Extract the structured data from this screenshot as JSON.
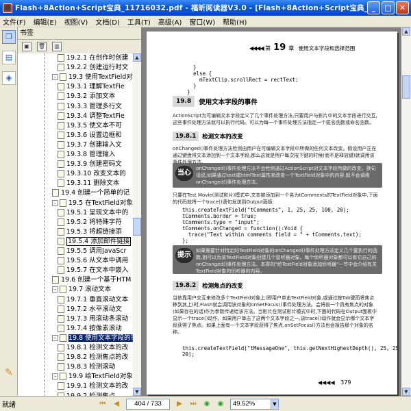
{
  "window": {
    "title": "Flash+8Action+Script宝典_11716032.pdf - 福昕阅读器V3.0 - [Flash+8Action+Script宝典_11...",
    "app_icon": "pdf-icon",
    "minimize": "_",
    "maximize": "□",
    "close": "✕"
  },
  "menu": [
    "文件(F)",
    "编辑(E)",
    "视图(V)",
    "文档(D)",
    "工具(T)",
    "高级(A)",
    "窗口(W)",
    "帮助(H)"
  ],
  "sidebar": {
    "header": "书签",
    "tabs": [
      "bookmark-icon",
      "pages-icon",
      "layers-icon"
    ]
  },
  "bookmarks": [
    {
      "label": "19.2.1 在创作时创建",
      "level": 2
    },
    {
      "label": "19.2.2 创建运行时文",
      "level": 2
    },
    {
      "label": "19.3 使用TextField对象",
      "level": 1,
      "expander": "-"
    },
    {
      "label": "19.3.1 理解TextFie",
      "level": 2
    },
    {
      "label": "19.3.2 添加文本",
      "level": 2
    },
    {
      "label": "19.3.3 管理多行文",
      "level": 2
    },
    {
      "label": "19.3.4 调整TextFie",
      "level": 2
    },
    {
      "label": "19.3.5 使文本不可",
      "level": 2
    },
    {
      "label": "19.3.6 设置边框和",
      "level": 2
    },
    {
      "label": "19.3.7 创建输入文",
      "level": 2
    },
    {
      "label": "19.3.8 管理输入",
      "level": 2
    },
    {
      "label": "19.3.9 创建密码文",
      "level": 2
    },
    {
      "label": "19.3.10 改变文本的",
      "level": 2
    },
    {
      "label": "19.3.11 删除文本",
      "level": 2
    },
    {
      "label": "19.4 创建一个简单的记",
      "level": 1
    },
    {
      "label": "19.5 在TextField对象中",
      "level": 1,
      "expander": "-"
    },
    {
      "label": "19.5.1 呈现文本中的",
      "level": 2
    },
    {
      "label": "19.5.2 将特殊字符",
      "level": 2
    },
    {
      "label": "19.5.3 将超链接添",
      "level": 2
    },
    {
      "label": "19.5.4 添加邮件链接",
      "level": 2,
      "boxed": true
    },
    {
      "label": "19.5.5 调用JavaScr",
      "level": 2
    },
    {
      "label": "19.5.6 从文本中调用",
      "level": 2
    },
    {
      "label": "19.5.7 在文本中嵌入",
      "level": 2
    },
    {
      "label": "19.6 创建一个基于HTM",
      "level": 1
    },
    {
      "label": "19.7 滚动文本",
      "level": 1,
      "expander": "-"
    },
    {
      "label": "19.7.1 垂直滚动文本",
      "level": 2
    },
    {
      "label": "19.7.2 水平滚动文",
      "level": 2
    },
    {
      "label": "19.7.3 用滚动条滚动",
      "level": 2
    },
    {
      "label": "19.7.4 按像素滚动",
      "level": 2
    },
    {
      "label": "19.8 使用文本字段的事",
      "level": 1,
      "expander": "-",
      "selected": true
    },
    {
      "label": "19.8.1 检测文本的改",
      "level": 2
    },
    {
      "label": "19.8.2 检测焦点的改",
      "level": 2
    },
    {
      "label": "19.8.3 检测滚动",
      "level": 2
    },
    {
      "label": "19.9 给TextField对象",
      "level": 1,
      "expander": "-"
    },
    {
      "label": "19.9.1 检测文本的改",
      "level": 2
    },
    {
      "label": "19.9.2 检测焦点",
      "level": 2
    }
  ],
  "doc": {
    "header_arrows": "◀◀◀◀",
    "header_chapter_pre": "第",
    "header_chapter_num": "19",
    "header_chapter_post": "章",
    "header_title": "使用文本字段和选择范围",
    "code1": "    }\n    else {\n      mTextClip.scrollRect = rectText;\n    }\n  }",
    "section_num": "19.8",
    "section_title": "使用文本字段的事件",
    "intro": "ActionScript为可编辑文本字段定义了几个事件处理方法,只要用户与影片中的文本字段进行交互,这些事件处理方法就可以执行代码。可以为每一个事件处理方法指定一个匿名函数或命名函数。",
    "sub1_num": "19.8.1",
    "sub1_title": "检测文本的改变",
    "para1": "onChanged()事件处理方法检测由用户在可编辑文本字段中所做的任何文本改变。假设用户正在通过键盘将文本添加到一个文本字段,那么这就是用户每次按下键的时候(而不是释放键)就调用该事件处理方法。",
    "note1_badge": "当心",
    "note1": "onChanged()事件处理方法不会检测通过ActionScript对文本字段所做的改变。换句话说,如果通过text或htmlText属性来改变一个TextField对象中的内容,就不会调用onChanged()事件处理方法。",
    "para2": "只要在Test Movie(测试影片)模式中,文本被添加到一个名为tComments的TextField对象中,下面的代码就将一个trace()语句发送到Output面板:",
    "code2": "this.createTextField(\"tComments\", 1, 25, 25, 100, 20);\ntComments.border = true;\ntComments.type = \"input\";\ntComments.onChanged = function():Void {\n  trace(\"Text within comments field = \" + tComments.text);\n};",
    "note2_badge": "提示",
    "note2": "如果需要针对特定的TextField对象的onChanged()事件处理方法定义几个要执行的函数,则可以为该TextField对象创建几个监听器对象。每个侦听器对象都可以有它自己的onChanged()事件处理方法。本章的\"给TextField对象添加侦听器\"一节中会介绍有关TextField对象的侦听器的内容。",
    "sub2_num": "19.8.2",
    "sub2_title": "检测焦点的改变",
    "para3": "当依靠用户交互来修改多个TextField对象上(即用户单击TextField对象,或通过按Tab键而将焦点移到其上)时,Flash就会调用该对象的onSetFocus()事件处理方法。会将前一个具有焦点的对象(如果存在的话)作为参数传递给该方法。当影片在测试影片模式中时,下面的代码在Output面板中显示一个trace()动作。如果用户单击了这两个文本字段之一,该trace()动作就会显示哪个文本字段获得了焦点。如果上面有一个文本字段获得了焦点,onSetFocus()方法也会报告那个对象的名称。",
    "code3": "this.createTextField(\"tMessageOne\", this.getNextHighestDepth(), 25, 25, 200,\n20);",
    "footer_arrows": "◀◀◀◀",
    "page_number": "379"
  },
  "status": {
    "text": "就绪",
    "page": "404 / 733",
    "zoom": "49.52%",
    "nav": [
      "first-page-icon",
      "prev-page-icon",
      "next-page-icon",
      "last-page-icon",
      "back-icon",
      "forward-icon"
    ]
  }
}
